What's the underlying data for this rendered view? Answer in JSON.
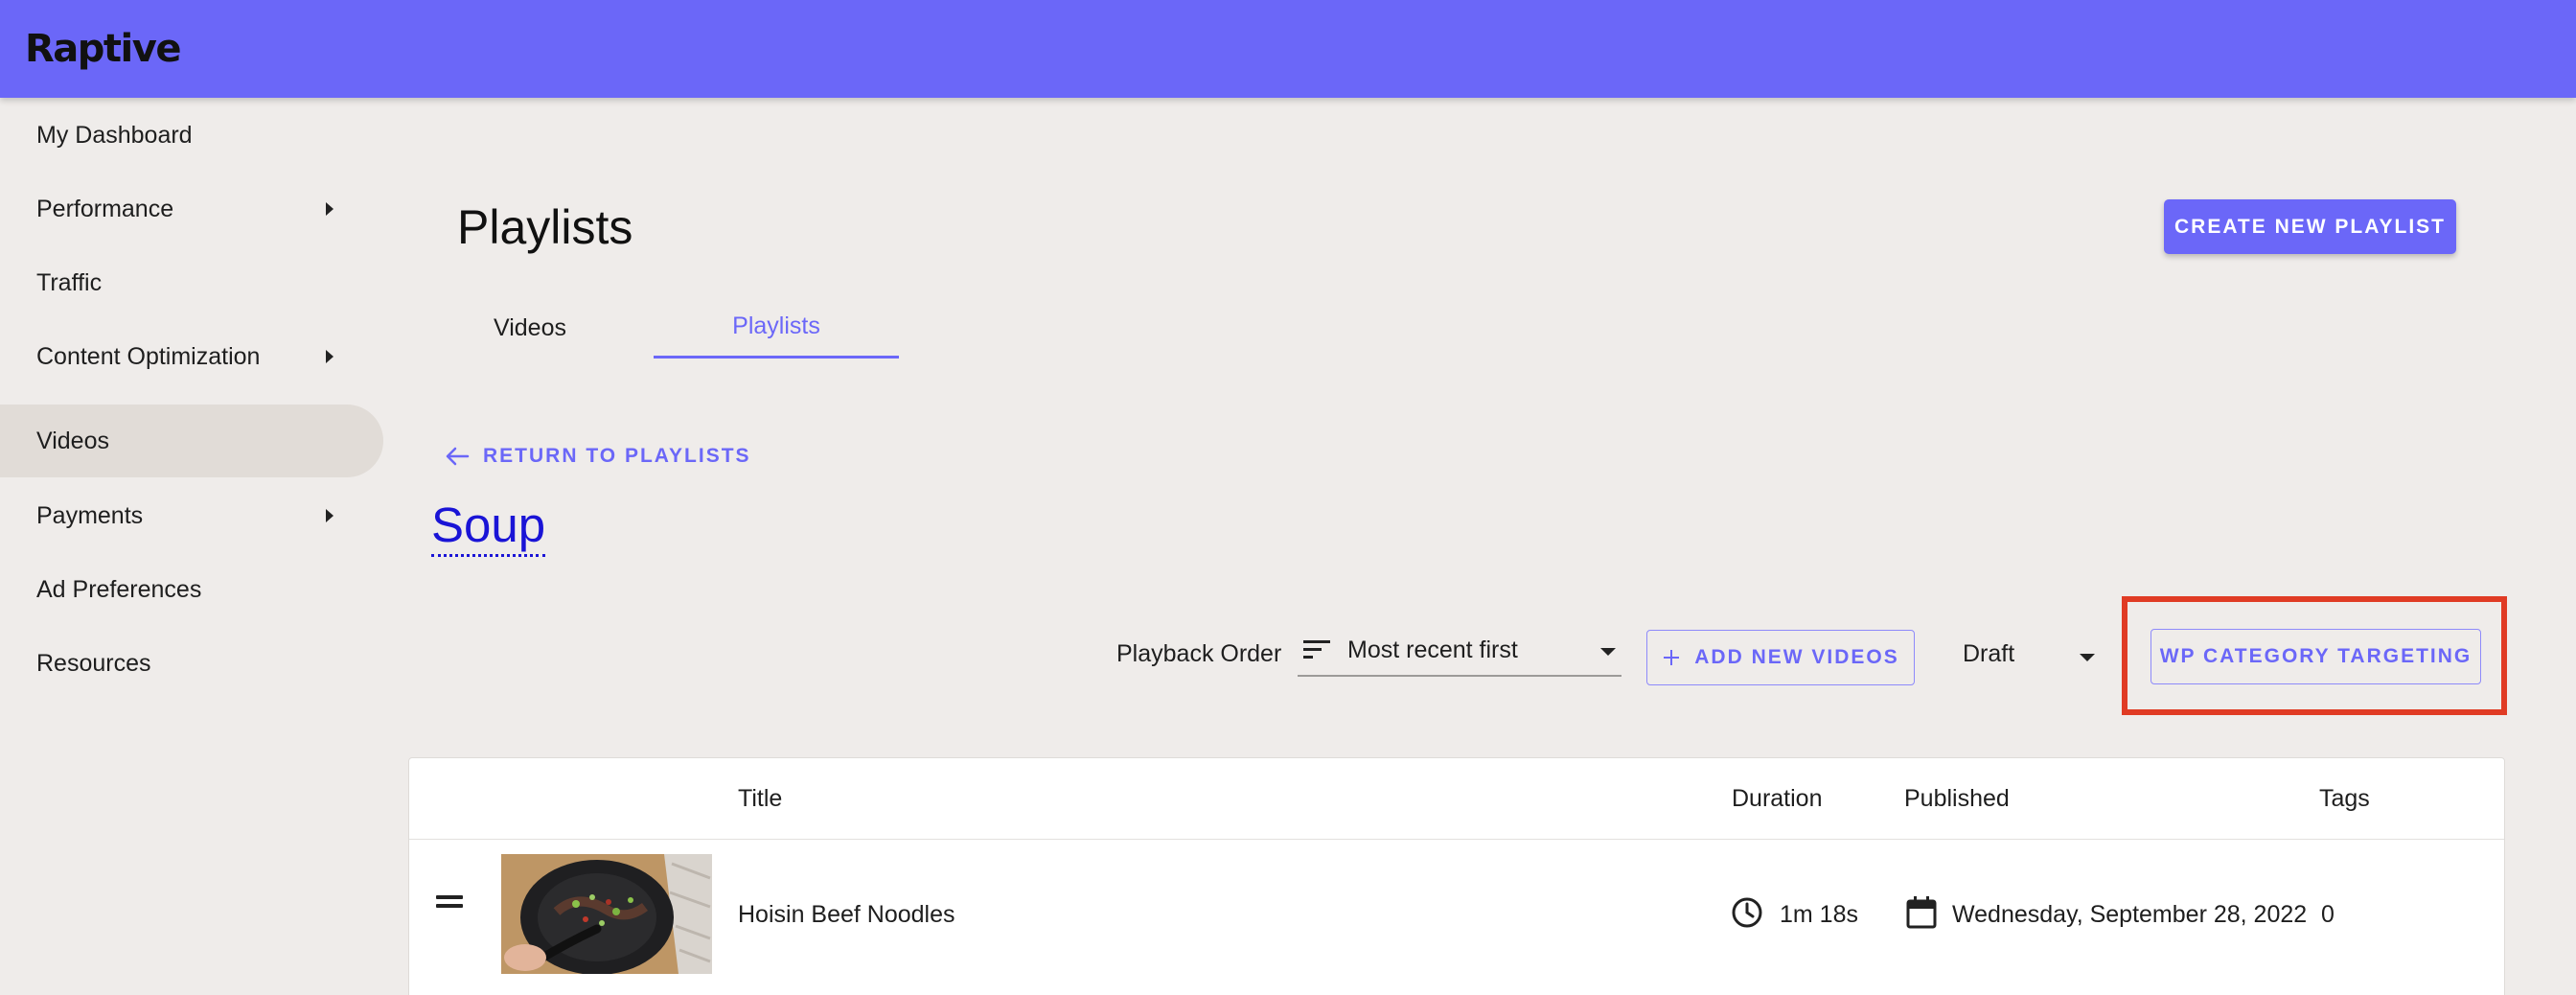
{
  "app": {
    "logo": "Raptive",
    "brand_color": "#6b67f8",
    "highlight_color": "#e03b24"
  },
  "sidebar": {
    "items": [
      {
        "label": "My Dashboard",
        "has_submenu": false,
        "active": false
      },
      {
        "label": "Performance",
        "has_submenu": true,
        "active": false
      },
      {
        "label": "Traffic",
        "has_submenu": false,
        "active": false
      },
      {
        "label": "Content Optimization",
        "has_submenu": true,
        "active": false
      },
      {
        "label": "Videos",
        "has_submenu": false,
        "active": true
      },
      {
        "label": "Payments",
        "has_submenu": true,
        "active": false
      },
      {
        "label": "Ad Preferences",
        "has_submenu": false,
        "active": false
      },
      {
        "label": "Resources",
        "has_submenu": false,
        "active": false
      }
    ]
  },
  "header": {
    "title": "Playlists",
    "create_button": "CREATE NEW PLAYLIST"
  },
  "tabs": [
    {
      "label": "Videos",
      "active": false
    },
    {
      "label": "Playlists",
      "active": true
    }
  ],
  "playlist": {
    "back_link": "RETURN TO PLAYLISTS",
    "name": "Soup",
    "playback_order_label": "Playback Order",
    "playback_order_value": "Most recent first",
    "add_videos_button": "ADD NEW VIDEOS",
    "status_value": "Draft",
    "wp_targeting_button": "WP CATEGORY TARGETING"
  },
  "table": {
    "columns": {
      "title": "Title",
      "duration": "Duration",
      "published": "Published",
      "tags": "Tags"
    },
    "rows": [
      {
        "title": "Hoisin Beef Noodles",
        "duration": "1m 18s",
        "published": "Wednesday, September 28, 2022",
        "tags": "0"
      }
    ]
  },
  "icons": [
    "arrow-left-icon",
    "sort-icon",
    "plus-icon",
    "clock-icon",
    "calendar-icon",
    "drag-handle-icon",
    "chevron-right-icon",
    "dropdown-arrow-icon"
  ]
}
